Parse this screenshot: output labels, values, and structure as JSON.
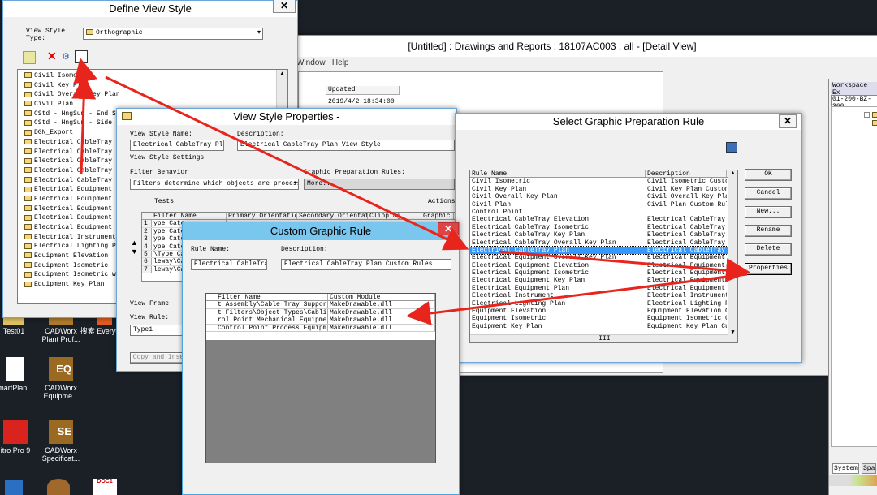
{
  "desktop": {
    "icons": [
      {
        "label": "Test01",
        "kind": "folder"
      },
      {
        "label": "CADWorx Plant Prof...",
        "kind": "cad"
      },
      {
        "label": "搜素 Everythi...",
        "kind": "search"
      },
      {
        "label": "martPlan...",
        "kind": "doc"
      },
      {
        "label": "CADWorx Equipme...",
        "kind": "EQ"
      },
      {
        "label": "itro Pro 9",
        "kind": "pdf"
      },
      {
        "label": "CADWorx Specificat...",
        "kind": "SE"
      },
      {
        "label": "DOC1",
        "kind": "doc"
      }
    ]
  },
  "main_window": {
    "title": "[Untitled] : Drawings and Reports : 18107AC003 : all - [Detail View]",
    "menu": [
      "Window",
      "Help"
    ],
    "column_header": "Updated",
    "row_value": "2019/4/2 18:34:00"
  },
  "workspace": {
    "title": "Workspace Ex",
    "path": "01-200-BZ-360",
    "tabs": [
      "System",
      "Spa"
    ]
  },
  "define_view_style": {
    "title": "Define View Style",
    "close": "✕",
    "view_style_type_label": "View Style Type:",
    "view_style_type_value": "Orthographic",
    "items": [
      "Civil Isometric",
      "Civil Key Plan",
      "Civil Overall Key Plan",
      "Civil Plan",
      "CStd - HngSum - End St",
      "CStd - HngSum - Side S",
      "DGN_Export",
      "Electrical CableTray E",
      "Electrical CableTray I",
      "Electrical CableTray K",
      "Electrical CableTray O",
      "Electrical CableTray P",
      "Electrical Equipment E",
      "Electrical Equipment I",
      "Electrical Equipment K",
      "Electrical Equipment O",
      "Electrical Equipment P",
      "Electrical Instrument S",
      "Electrical Lighting Pl",
      "Equipment Elevation",
      "Equipment Isometric",
      "Equipment Isometric wi",
      "Equipment Key Plan"
    ]
  },
  "view_style_properties": {
    "title": "View Style Properties -",
    "name_label": "View Style Name:",
    "name_value": "Electrical CableTray Plan",
    "desc_label": "Description:",
    "desc_value": "Electrical CableTray Plan View Style",
    "settings_label": "View Style Settings",
    "filter_label": "Filter Behavior",
    "filter_value": "Filters determine which objects are processe",
    "gpr_label": "Graphic Preparation Rules:",
    "gpr_value": "More...",
    "tests_label": "Tests",
    "actions_label": "Actions",
    "grid_headers": [
      "Filter Name",
      "Primary Orientation",
      "Secondary Orientati",
      "Clipping"
    ],
    "graphic_label": "Graphic",
    "rows": [
      "ype Cate",
      "ype Cate",
      "ype Cate",
      "ype Cate",
      "\\Type Ca",
      "leway\\Ca",
      "leway\\Ca"
    ],
    "frame_label": "View Frame",
    "rule_label": "View Rule:",
    "rule_value": "Type1",
    "copy_btn": "Copy and Inse"
  },
  "custom_graphic_rule": {
    "title": "Custom Graphic Rule",
    "close": "✕",
    "rule_name_label": "Rule Name:",
    "rule_name_value": "Electrical CableTray",
    "desc_label": "Description:",
    "desc_value": "Electrical CableTray Plan Custom Rules",
    "headers": [
      "Filter Name",
      "Custom Module"
    ],
    "rows": [
      {
        "filter": "t Assembly\\Cable Tray Supports",
        "module": "MakeDrawable.dll"
      },
      {
        "filter": "t Filters\\Object Types\\Cabling",
        "module": "MakeDrawable.dll"
      },
      {
        "filter": "rol Point Mechanical Equipment",
        "module": "MakeDrawable.dll"
      },
      {
        "filter": "Control Point Process Equipment",
        "module": "MakeDrawable.dll"
      }
    ]
  },
  "select_rule": {
    "title": "Select Graphic Preparation Rule",
    "close": "✕",
    "headers": [
      "Rule Name",
      "Description"
    ],
    "rows": [
      {
        "name": "Civil Isometric",
        "desc": "Civil Isometric Custom"
      },
      {
        "name": "Civil Key Plan",
        "desc": "Civil Key Plan Custom"
      },
      {
        "name": "Civil Overall Key Plan",
        "desc": "Civil Overall Key Plan"
      },
      {
        "name": "Civil Plan",
        "desc": "Civil Plan Custom Rule"
      },
      {
        "name": "Control Point",
        "desc": ""
      },
      {
        "name": "Electrical CableTray Elevation",
        "desc": "Electrical CableTray E"
      },
      {
        "name": "Electrical CableTray Isometric",
        "desc": "Electrical CableTray I"
      },
      {
        "name": "Electrical CableTray Key Plan",
        "desc": "Electrical CableTray K"
      },
      {
        "name": "Electrical CableTray Overall Key Plan",
        "desc": "Electrical CableTray K"
      },
      {
        "name": "Electrical CableTray Plan",
        "desc": "Electrical CableTray P"
      },
      {
        "name": "Electrical Equipment Overall Key Plan",
        "desc": "Electrical Equipment K"
      },
      {
        "name": "Electrical Equipment Elevation",
        "desc": "Electrical Equipment"
      },
      {
        "name": "Electrical Equipment Isometric",
        "desc": "Electrical Equipment I"
      },
      {
        "name": "Electrical Equipment Key Plan",
        "desc": "Electrical Equipment K"
      },
      {
        "name": "Electrical Equipment Plan",
        "desc": "Electrical Equipment P"
      },
      {
        "name": "Electrical Instrument",
        "desc": "Electrical Instrument"
      },
      {
        "name": "Electrical Lighting Plan",
        "desc": "Electrical Lighting Pl"
      },
      {
        "name": "Equipment Elevation",
        "desc": "Equipment Elevation Cu"
      },
      {
        "name": "Equipment Isometric",
        "desc": "Equipment Isometric Cu"
      },
      {
        "name": "Equipment Key Plan",
        "desc": "Equipment Key Plan Cus"
      }
    ],
    "selected_index": 9,
    "buttons": [
      "OK",
      "Cancel",
      "New...",
      "Rename",
      "Delete",
      "Properties"
    ],
    "scroll_mark": "III"
  },
  "colors": {
    "arrow": "#e8251c",
    "title_blue": "#79c7ee",
    "selection": "#3399ff"
  }
}
